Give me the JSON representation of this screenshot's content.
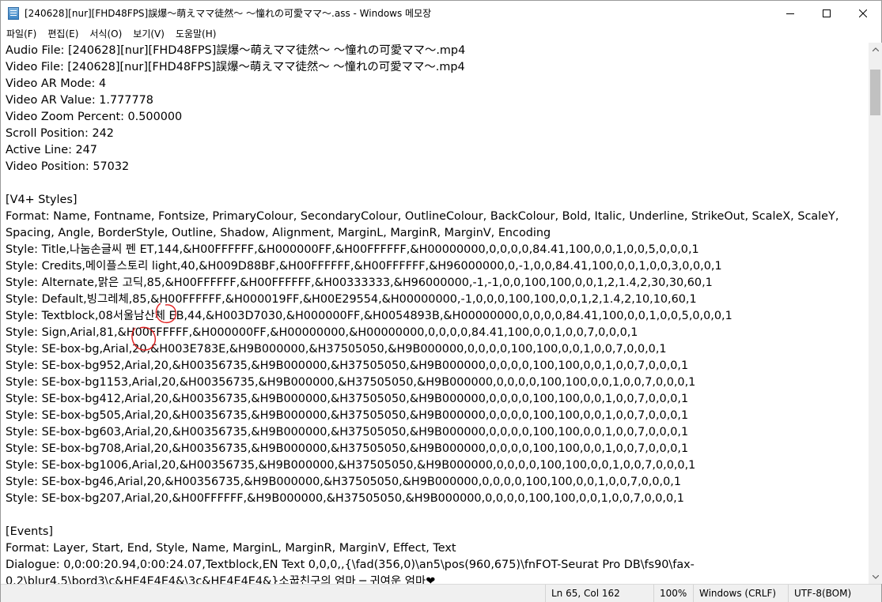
{
  "window": {
    "title": "[240628][nur][FHD48FPS]誤爆～萌えママ徒然～ ～憧れの可愛ママ～.ass - Windows 메모장"
  },
  "menu": {
    "items": [
      {
        "label": "파일(F)"
      },
      {
        "label": "편집(E)"
      },
      {
        "label": "서식(O)"
      },
      {
        "label": "보기(V)"
      },
      {
        "label": "도움말(H)"
      }
    ]
  },
  "editor": {
    "lines": [
      "Audio File: [240628][nur][FHD48FPS]誤爆～萌えママ徒然～ ～憧れの可愛ママ～.mp4",
      "Video File: [240628][nur][FHD48FPS]誤爆～萌えママ徒然～ ～憧れの可愛ママ～.mp4",
      "Video AR Mode: 4",
      "Video AR Value: 1.777778",
      "Video Zoom Percent: 0.500000",
      "Scroll Position: 242",
      "Active Line: 247",
      "Video Position: 57032",
      "",
      "[V4+ Styles]",
      "Format: Name, Fontname, Fontsize, PrimaryColour, SecondaryColour, OutlineColour, BackColour, Bold, Italic, Underline, StrikeOut, ScaleX, ScaleY,",
      "Spacing, Angle, BorderStyle, Outline, Shadow, Alignment, MarginL, MarginR, MarginV, Encoding",
      "Style: Title,나눔손글씨 펜 ET,144,&H00FFFFFF,&H000000FF,&H00FFFFFF,&H00000000,0,0,0,0,84.41,100,0,0,1,0,0,5,0,0,0,1",
      "Style: Credits,메이플스토리 light,40,&H009D88BF,&H00FFFFFF,&H00FFFFFF,&H96000000,0,-1,0,0,84.41,100,0,0,1,0,0,3,0,0,0,1",
      "Style: Alternate,맑은 고딕,85,&H00FFFFFF,&H00FFFFFF,&H00333333,&H96000000,-1,-1,0,0,100,100,0,0,1,2,1.4,2,30,30,60,1",
      "Style: Default,빙그레체,85,&H00FFFFFF,&H000019FF,&H00E29554,&H00000000,-1,0,0,0,100,100,0,0,1,2,1.4,2,10,10,60,1",
      "Style: Textblock,08서울남산체 EB,44,&H003D7030,&H000000FF,&H0054893B,&H00000000,0,0,0,0,84.41,100,0,0,1,0,0,5,0,0,0,1",
      "Style: Sign,Arial,81,&H00FFFFFF,&H000000FF,&H00000000,&H00000000,0,0,0,0,84.41,100,0,0,1,0,0,7,0,0,0,1",
      "Style: SE-box-bg,Arial,20,&H003E783E,&H9B000000,&H37505050,&H9B000000,0,0,0,0,100,100,0,0,1,0,0,7,0,0,0,1",
      "Style: SE-box-bg952,Arial,20,&H00356735,&H9B000000,&H37505050,&H9B000000,0,0,0,0,100,100,0,0,1,0,0,7,0,0,0,1",
      "Style: SE-box-bg1153,Arial,20,&H00356735,&H9B000000,&H37505050,&H9B000000,0,0,0,0,100,100,0,0,1,0,0,7,0,0,0,1",
      "Style: SE-box-bg412,Arial,20,&H00356735,&H9B000000,&H37505050,&H9B000000,0,0,0,0,100,100,0,0,1,0,0,7,0,0,0,1",
      "Style: SE-box-bg505,Arial,20,&H00356735,&H9B000000,&H37505050,&H9B000000,0,0,0,0,100,100,0,0,1,0,0,7,0,0,0,1",
      "Style: SE-box-bg603,Arial,20,&H00356735,&H9B000000,&H37505050,&H9B000000,0,0,0,0,100,100,0,0,1,0,0,7,0,0,0,1",
      "Style: SE-box-bg708,Arial,20,&H00356735,&H9B000000,&H37505050,&H9B000000,0,0,0,0,100,100,0,0,1,0,0,7,0,0,0,1",
      "Style: SE-box-bg1006,Arial,20,&H00356735,&H9B000000,&H37505050,&H9B000000,0,0,0,0,100,100,0,0,1,0,0,7,0,0,0,1",
      "Style: SE-box-bg46,Arial,20,&H00356735,&H9B000000,&H37505050,&H9B000000,0,0,0,0,100,100,0,0,1,0,0,7,0,0,0,1",
      "Style: SE-box-bg207,Arial,20,&H00FFFFFF,&H9B000000,&H37505050,&H9B000000,0,0,0,0,100,100,0,0,1,0,0,7,0,0,0,1",
      "",
      "[Events]",
      "Format: Layer, Start, End, Style, Name, MarginL, MarginR, MarginV, Effect, Text",
      "Dialogue: 0,0:00:20.94,0:00:24.07,Textblock,EN Text 0,0,0,,{\\fad(356,0)\\an5\\pos(960,675)\\fnFOT-Seurat Pro DB\\fs90\\fax-",
      "0.2\\blur4.5\\bord3\\c&HE4E4E4&\\3c&HE4E4E4&}소꿉친구의 엄마 ─ 귀여운 엄마❤"
    ]
  },
  "status": {
    "position": "Ln 65, Col 162",
    "zoom": "100%",
    "line_ending": "Windows (CRLF)",
    "encoding": "UTF-8(BOM)"
  },
  "annotation_color": "#e02020"
}
